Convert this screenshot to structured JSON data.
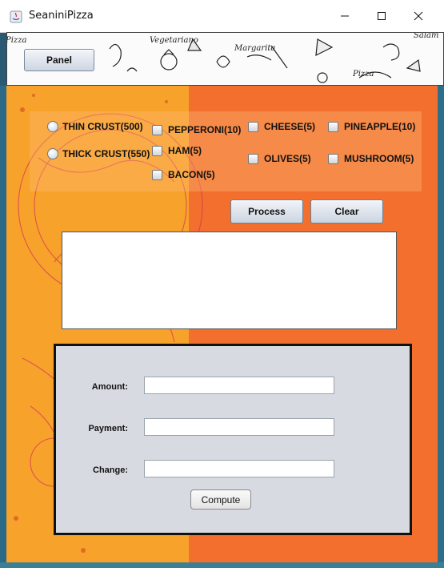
{
  "window": {
    "title": "SeaniniPizza",
    "controls": [
      "minimize-icon",
      "maximize-icon",
      "close-icon"
    ]
  },
  "banner": {
    "panel_button": "Panel",
    "doodle_words": [
      "Pizza",
      "Vegetariano",
      "Margarita",
      "Pizza",
      "Salam"
    ]
  },
  "crust_options": [
    {
      "label": "THIN CRUST(500)",
      "selected": false
    },
    {
      "label": "THICK CRUST(550)",
      "selected": false
    }
  ],
  "toppings": [
    {
      "label": "PEPPERONI(10)",
      "checked": false
    },
    {
      "label": "HAM(5)",
      "checked": false
    },
    {
      "label": "BACON(5)",
      "checked": false
    },
    {
      "label": "CHEESE(5)",
      "checked": false
    },
    {
      "label": "OLIVES(5)",
      "checked": false
    },
    {
      "label": "PINEAPPLE(10)",
      "checked": false
    },
    {
      "label": "MUSHROOM(5)",
      "checked": false
    }
  ],
  "actions": {
    "process": "Process",
    "clear": "Clear"
  },
  "output_area": {
    "value": ""
  },
  "payment": {
    "amount_label": "Amount:",
    "amount_value": "",
    "payment_label": "Payment:",
    "payment_value": "",
    "change_label": "Change:",
    "change_value": "",
    "compute_button": "Compute"
  },
  "colors": {
    "orange_dark": "#f26f2e",
    "orange_light": "#f7a22a",
    "panel_gray": "#d7dae1"
  }
}
